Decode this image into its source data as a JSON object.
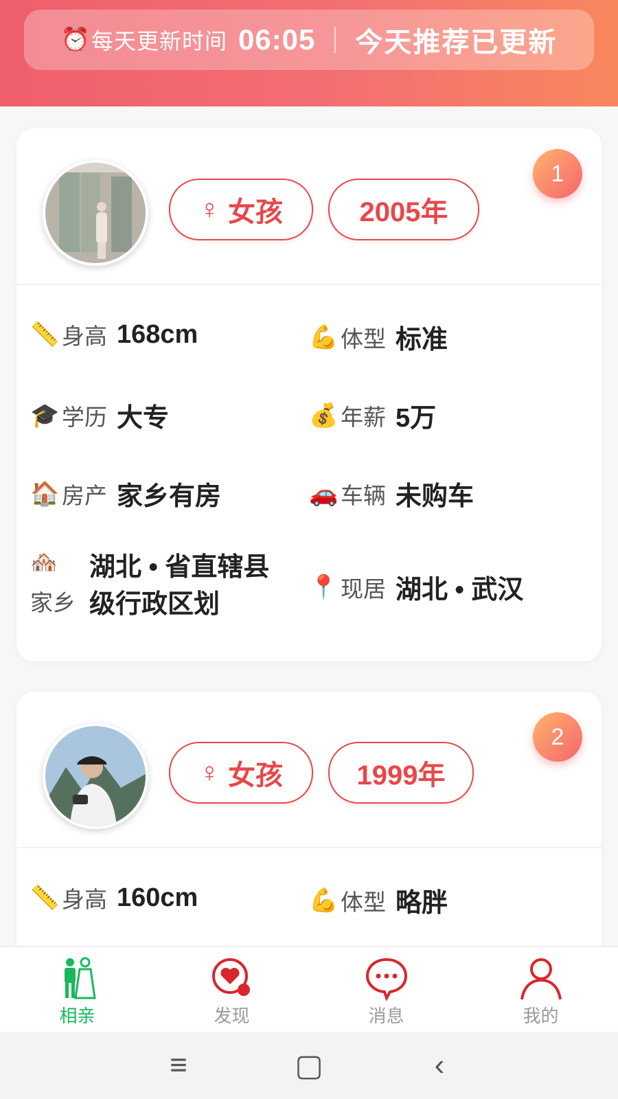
{
  "banner": {
    "clock_icon": "⏰",
    "label": "每天更新时间",
    "time": "06:05",
    "status": "今天推荐已更新"
  },
  "cards": [
    {
      "rank": "1",
      "gender_symbol": "♀",
      "gender": "女孩",
      "birth_year": "2005年",
      "height": {
        "icon": "📏",
        "label": "身高",
        "value": "168cm"
      },
      "body": {
        "icon": "💪",
        "label": "体型",
        "value": "标准"
      },
      "education": {
        "icon": "🎓",
        "label": "学历",
        "value": "大专"
      },
      "salary": {
        "icon": "💰",
        "label": "年薪",
        "value": "5万"
      },
      "property": {
        "icon": "🏠",
        "label": "房产",
        "value": "家乡有房"
      },
      "vehicle": {
        "icon": "🚗",
        "label": "车辆",
        "value": "未购车"
      },
      "hometown": {
        "icon": "🏘️",
        "label": "家乡",
        "value": "湖北 • 省直辖县级行政区划"
      },
      "residence": {
        "icon": "📍",
        "label": "现居",
        "value": "湖北 • 武汉"
      }
    },
    {
      "rank": "2",
      "gender_symbol": "♀",
      "gender": "女孩",
      "birth_year": "1999年",
      "height": {
        "icon": "📏",
        "label": "身高",
        "value": "160cm"
      },
      "body": {
        "icon": "💪",
        "label": "体型",
        "value": "略胖"
      }
    }
  ],
  "tabs": [
    {
      "label": "相亲",
      "active": true
    },
    {
      "label": "发现",
      "active": false
    },
    {
      "label": "消息",
      "active": false
    },
    {
      "label": "我的",
      "active": false
    }
  ],
  "colors": {
    "accent": "#e8474b",
    "active_tab": "#19b85c"
  },
  "system_nav": {
    "menu": "≡",
    "home": "▢",
    "back": "‹"
  }
}
